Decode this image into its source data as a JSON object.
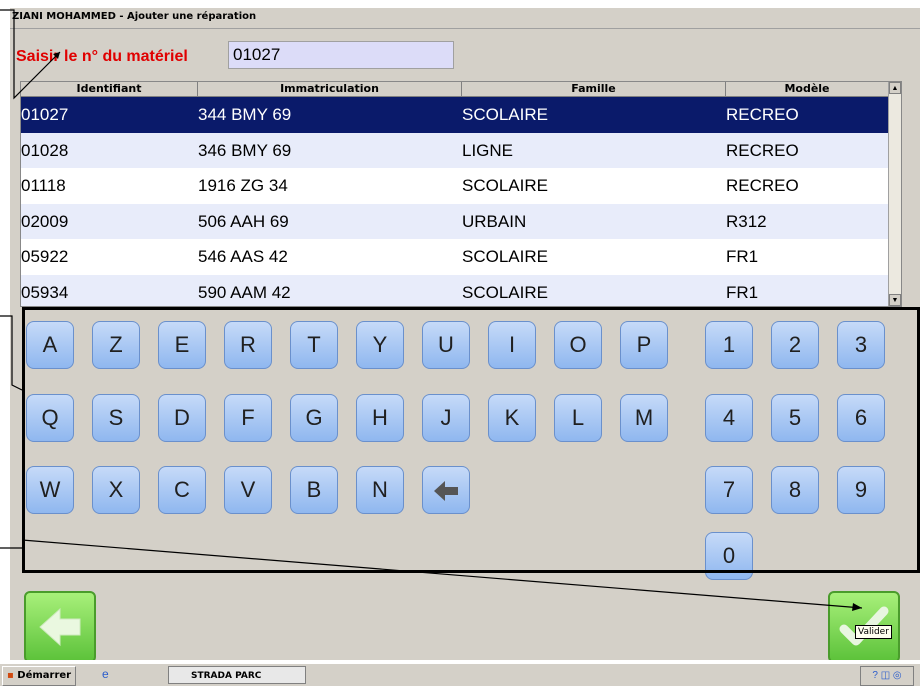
{
  "window": {
    "title": "ZIANI MOHAMMED - Ajouter une réparation"
  },
  "prompt": {
    "label": "Saisir le  n° du matériel",
    "value": "01027"
  },
  "table": {
    "columns": [
      "Identifiant",
      "Immatriculation",
      "Famille",
      "Modèle"
    ],
    "rows": [
      [
        "01027",
        "344 BMY 69",
        "SCOLAIRE",
        "RECREO"
      ],
      [
        "01028",
        "346 BMY 69",
        "LIGNE",
        "RECREO"
      ],
      [
        "01118",
        "1916 ZG 34",
        "SCOLAIRE",
        "RECREO"
      ],
      [
        "02009",
        "506 AAH 69",
        "URBAIN",
        "R312"
      ],
      [
        "05922",
        "546 AAS 42",
        "SCOLAIRE",
        "FR1"
      ],
      [
        "05934",
        "590 AAM 42",
        "SCOLAIRE",
        "FR1"
      ]
    ],
    "selected_row": 0
  },
  "keyboard": {
    "row1": [
      "A",
      "Z",
      "E",
      "R",
      "T",
      "Y",
      "U",
      "I",
      "O",
      "P"
    ],
    "row2": [
      "Q",
      "S",
      "D",
      "F",
      "G",
      "H",
      "J",
      "K",
      "L",
      "M"
    ],
    "row3": [
      "W",
      "X",
      "C",
      "V",
      "B",
      "N"
    ],
    "backspace": "backspace-arrow-icon",
    "numpad": [
      "1",
      "2",
      "3",
      "4",
      "5",
      "6",
      "7",
      "8",
      "9",
      "0"
    ]
  },
  "buttons": {
    "back_icon": "arrow-left-icon",
    "validate_icon": "checkmark-icon",
    "validate_tooltip": "Valider"
  },
  "taskbar": {
    "start_label": "Démarrer",
    "task_label": "STRADA PARC"
  },
  "colors": {
    "selection": "#0a1a6a",
    "prompt_label": "#e00000",
    "key": "#a8c8f4",
    "green_button": "#5cc23a"
  }
}
